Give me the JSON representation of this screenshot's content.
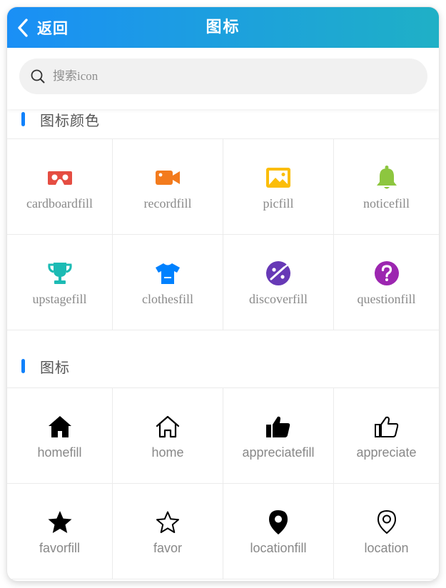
{
  "header": {
    "back_label": "返回",
    "title": "图标"
  },
  "search": {
    "placeholder": "搜索icon"
  },
  "sections": [
    {
      "title": "图标颜色",
      "items": [
        {
          "label": "cardboardfill",
          "icon": "cardboard-icon",
          "color": "#e54d42"
        },
        {
          "label": "recordfill",
          "icon": "video-camera-icon",
          "color": "#f37b1d"
        },
        {
          "label": "picfill",
          "icon": "picture-icon",
          "color": "#fbbd08"
        },
        {
          "label": "noticefill",
          "icon": "bell-icon",
          "color": "#8dc63f"
        },
        {
          "label": "upstagefill",
          "icon": "trophy-icon",
          "color": "#1cbbb4"
        },
        {
          "label": "clothesfill",
          "icon": "tshirt-icon",
          "color": "#0081ff"
        },
        {
          "label": "discoverfill",
          "icon": "planet-icon",
          "color": "#6739b6"
        },
        {
          "label": "questionfill",
          "icon": "question-circle-icon",
          "color": "#9c26b0"
        }
      ]
    },
    {
      "title": "图标",
      "items": [
        {
          "label": "homefill",
          "icon": "home-filled-icon"
        },
        {
          "label": "home",
          "icon": "home-outline-icon"
        },
        {
          "label": "appreciatefill",
          "icon": "thumbs-up-filled-icon"
        },
        {
          "label": "appreciate",
          "icon": "thumbs-up-outline-icon"
        },
        {
          "label": "favorfill",
          "icon": "star-filled-icon"
        },
        {
          "label": "favor",
          "icon": "star-outline-icon"
        },
        {
          "label": "locationfill",
          "icon": "location-filled-icon"
        },
        {
          "label": "location",
          "icon": "location-outline-icon"
        }
      ]
    }
  ]
}
